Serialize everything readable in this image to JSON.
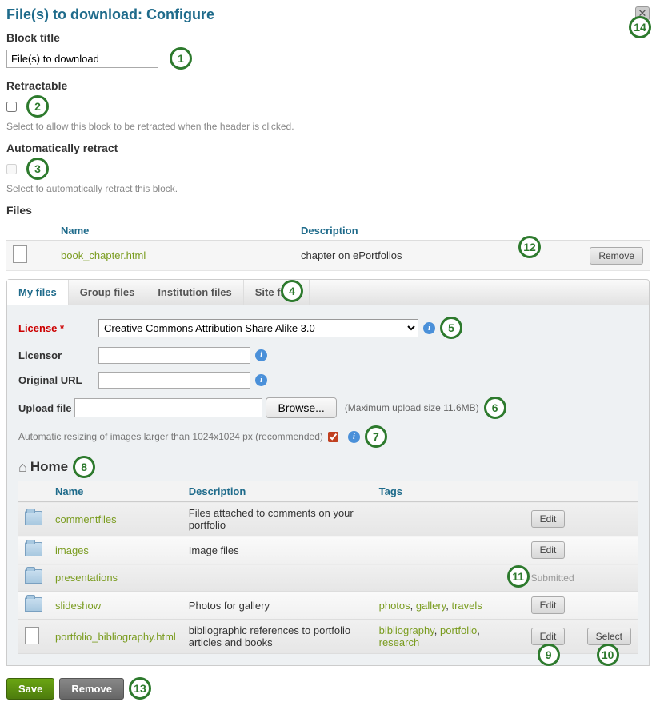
{
  "header": {
    "title": "File(s) to download: Configure"
  },
  "block_title": {
    "label": "Block title",
    "value": "File(s) to download"
  },
  "retractable": {
    "label": "Retractable",
    "help": "Select to allow this block to be retracted when the header is clicked."
  },
  "auto_retract": {
    "label": "Automatically retract",
    "help": "Select to automatically retract this block."
  },
  "files_section": {
    "label": "Files",
    "cols": {
      "name": "Name",
      "description": "Description"
    },
    "rows": [
      {
        "name": "book_chapter.html",
        "description": "chapter on ePortfolios",
        "remove": "Remove"
      }
    ]
  },
  "tabs": {
    "my": "My files",
    "group": "Group files",
    "inst": "Institution files",
    "site": "Site files"
  },
  "license": {
    "label": "License",
    "required": "*",
    "value": "Creative Commons Attribution Share Alike 3.0",
    "licensor_label": "Licensor",
    "url_label": "Original URL"
  },
  "upload": {
    "label": "Upload file",
    "browse": "Browse...",
    "note": "(Maximum upload size 11.6MB)",
    "resize": "Automatic resizing of images larger than 1024x1024 px (recommended)"
  },
  "breadcrumb": {
    "home": "Home"
  },
  "browser": {
    "cols": {
      "name": "Name",
      "description": "Description",
      "tags": "Tags"
    },
    "edit": "Edit",
    "select": "Select",
    "submitted": "Submitted",
    "rows": [
      {
        "type": "folder",
        "name": "commentfiles",
        "description": "Files attached to comments on your portfolio",
        "tags": [],
        "edit": true
      },
      {
        "type": "folder",
        "name": "images",
        "description": "Image files",
        "tags": [],
        "edit": true
      },
      {
        "type": "folder",
        "name": "presentations",
        "description": "",
        "tags": [],
        "submitted": true
      },
      {
        "type": "folder",
        "name": "slideshow",
        "description": "Photos for gallery",
        "tags": [
          "photos",
          "gallery",
          "travels"
        ],
        "edit": true
      },
      {
        "type": "file",
        "name": "portfolio_bibliography.html",
        "description": "bibliographic references to portfolio articles and books",
        "tags": [
          "bibliography",
          "portfolio",
          "research"
        ],
        "edit": true,
        "select": true
      }
    ]
  },
  "actions": {
    "save": "Save",
    "remove": "Remove"
  },
  "annots": [
    "1",
    "2",
    "3",
    "4",
    "5",
    "6",
    "7",
    "8",
    "9",
    "10",
    "11",
    "12",
    "13",
    "14"
  ]
}
